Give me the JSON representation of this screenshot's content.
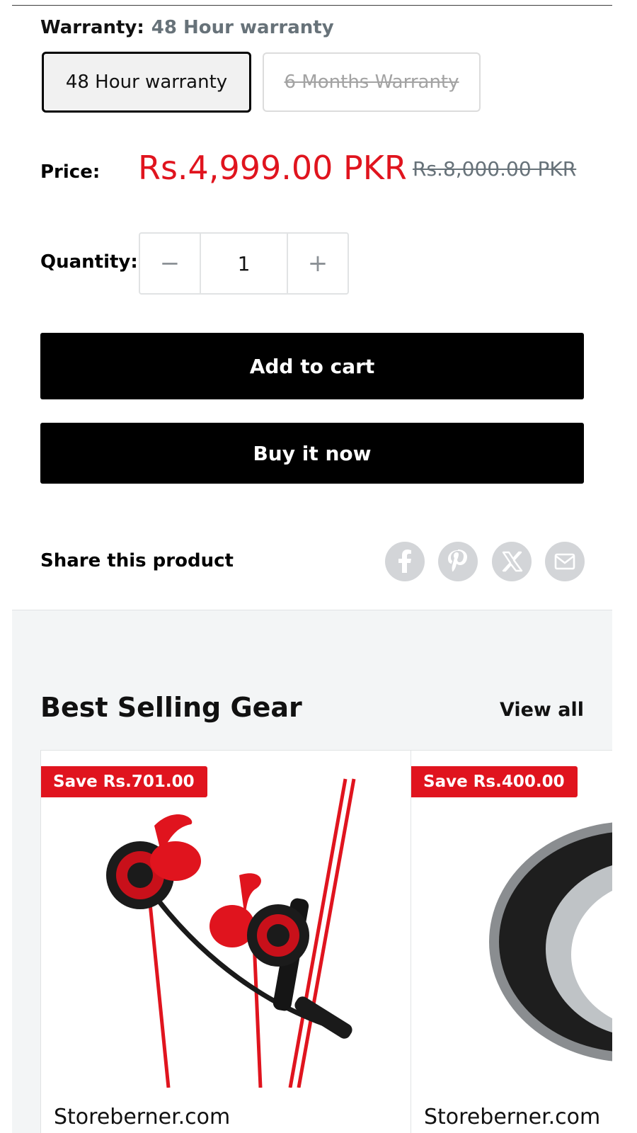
{
  "product": {
    "warranty_label": "Warranty:",
    "warranty_value": "48 Hour warranty",
    "options": [
      "48 Hour warranty",
      "6 Months Warranty"
    ],
    "price_label": "Price:",
    "sale_price": "Rs.4,999.00 PKR",
    "compare_price": "Rs.8,000.00 PKR",
    "quantity_label": "Quantity:",
    "quantity_value": "1",
    "minus": "−",
    "plus": "+",
    "add_to_cart": "Add to cart",
    "buy_now": "Buy it now",
    "share_label": "Share this product"
  },
  "share_icons": [
    "facebook-icon",
    "pinterest-icon",
    "x-icon",
    "email-icon"
  ],
  "best_selling": {
    "title": "Best Selling Gear",
    "view_all": "View all",
    "cards": [
      {
        "badge": "Save Rs.701.00",
        "vendor": "Storeberner.com",
        "image": "red-gaming-earphones"
      },
      {
        "badge": "Save Rs.400.00",
        "vendor": "Storeberner.com",
        "image": "smart-ring-38"
      }
    ]
  },
  "colors": {
    "sale_red": "#e0141e",
    "muted_gray": "#677279",
    "share_gray": "#d3d5d8"
  }
}
